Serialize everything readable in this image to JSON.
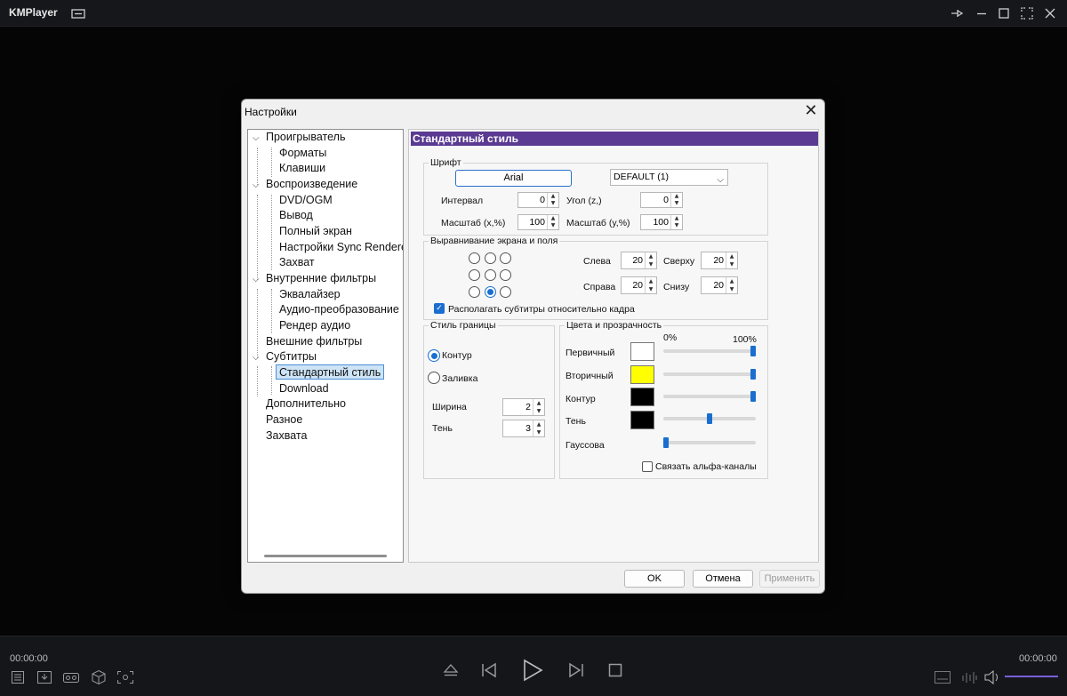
{
  "app": {
    "title": "KMPlayer",
    "time_left": "00:00:00",
    "time_right": "00:00:00"
  },
  "dialog": {
    "title": "Настройки",
    "buttons": {
      "ok": "OK",
      "cancel": "Отмена",
      "apply": "Применить"
    }
  },
  "tree": {
    "items": [
      "Проигрыватель",
      "Форматы",
      "Клавиши",
      "Воспроизведение",
      "DVD/OGM",
      "Вывод",
      "Полный экран",
      "Настройки Sync Renderer",
      "Захват",
      "Внутренние фильтры",
      "Эквалайзер",
      "Аудио-преобразование",
      "Рендер аудио",
      "Внешние фильтры",
      "Субтитры",
      "Стандартный стиль",
      "Download",
      "Дополнительно",
      "Разное",
      "Захвата"
    ],
    "selected": "Стандартный стиль"
  },
  "panel": {
    "header": "Стандартный стиль",
    "font": {
      "title": "Шрифт",
      "font_button": "Arial",
      "charset": "DEFAULT (1)",
      "interval_label": "Интервал",
      "interval": "0",
      "angle_label": "Угол (z,)",
      "angle": "0",
      "scale_x_label": "Масштаб (x,%)",
      "scale_x": "100",
      "scale_y_label": "Масштаб (y,%)",
      "scale_y": "100"
    },
    "alignment": {
      "title": "Выравнивание экрана и поля",
      "selected_position": "bottom-center",
      "left_label": "Слева",
      "left": "20",
      "top_label": "Сверху",
      "top": "20",
      "right_label": "Справа",
      "right": "20",
      "bottom_label": "Снизу",
      "bottom": "20",
      "relative_checkbox": "Располагать субтитры относительно кадра",
      "relative_checked": true
    },
    "border": {
      "title": "Стиль границы",
      "outline": "Контур",
      "fill": "Заливка",
      "selected": "outline",
      "width_label": "Ширина",
      "width": "2",
      "shadow_label": "Тень",
      "shadow": "3"
    },
    "colors": {
      "title": "Цвета и прозрачность",
      "pct_min": "0%",
      "pct_max": "100%",
      "rows": [
        {
          "label": "Первичный",
          "color": "#ffffff",
          "alpha": 1.0
        },
        {
          "label": "Вторичный",
          "color": "#ffff00",
          "alpha": 1.0
        },
        {
          "label": "Контур",
          "color": "#000000",
          "alpha": 1.0
        },
        {
          "label": "Тень",
          "color": "#000000",
          "alpha": 0.5
        },
        {
          "label": "Гауссова",
          "color": null,
          "alpha": 0.0
        }
      ],
      "link_alpha": "Связать альфа-каналы",
      "link_alpha_checked": false
    }
  },
  "colors": {
    "accent": "#5a3a92",
    "highlight": "#1a6ed0",
    "volume": "#7b5fd9"
  }
}
